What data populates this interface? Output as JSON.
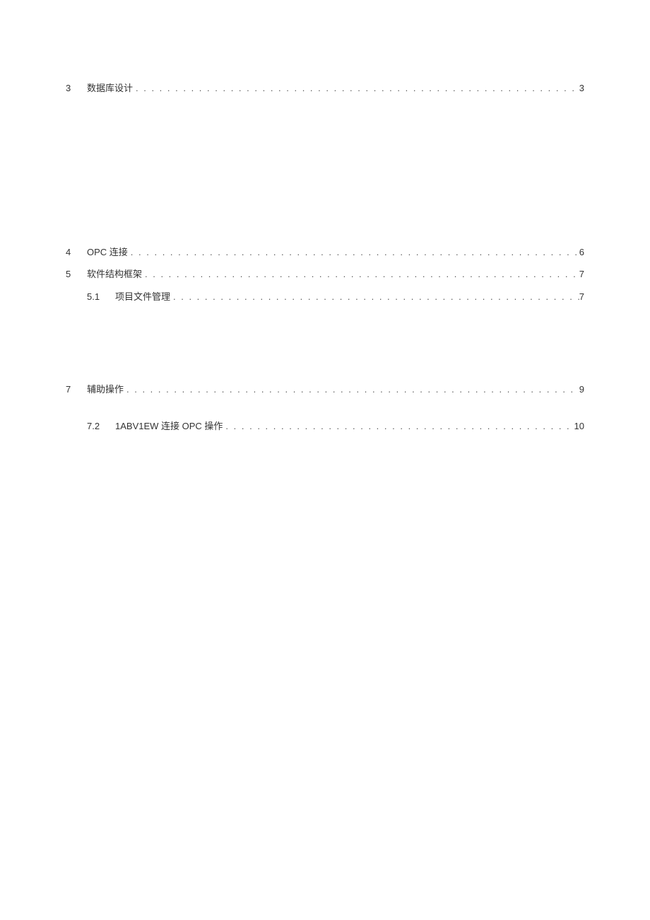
{
  "toc": {
    "entry_3": {
      "num": "3",
      "title": "数据库设计",
      "page": "3"
    },
    "entry_4": {
      "num": "4",
      "title": "OPC 连接",
      "page": "6"
    },
    "entry_5": {
      "num": "5",
      "title": "软件结构框架",
      "page": "7"
    },
    "entry_5_1": {
      "num": "5.1",
      "title": "项目文件管理",
      "page": "7"
    },
    "entry_7": {
      "num": "7",
      "title": "辅助操作",
      "page": "9"
    },
    "entry_7_2": {
      "num": "7.2",
      "title": "1ABV1EW 连接 OPC 操作",
      "page": "10"
    }
  }
}
